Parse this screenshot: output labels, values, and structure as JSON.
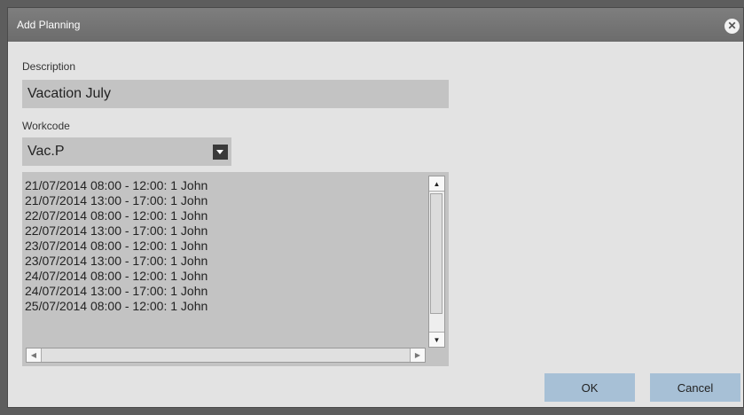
{
  "dialog": {
    "title": "Add Planning",
    "close_icon": "close-icon"
  },
  "description": {
    "label": "Description",
    "value": "Vacation July"
  },
  "workcode": {
    "label": "Workcode",
    "selected": "Vac.P"
  },
  "planning_list": {
    "items": [
      "21/07/2014 08:00 - 12:00: 1 John",
      "21/07/2014 13:00 - 17:00: 1 John",
      "22/07/2014 08:00 - 12:00: 1 John",
      "22/07/2014 13:00 - 17:00: 1 John",
      "23/07/2014 08:00 - 12:00: 1 John",
      "23/07/2014 13:00 - 17:00: 1 John",
      "24/07/2014 08:00 - 12:00: 1 John",
      "24/07/2014 13:00 - 17:00: 1 John",
      "25/07/2014 08:00 - 12:00: 1 John"
    ]
  },
  "buttons": {
    "ok_label": "OK",
    "cancel_label": "Cancel"
  },
  "colors": {
    "titlebar": "#737373",
    "dialog_background": "#e3e3e3",
    "field_background": "#c3c3c3",
    "button_accent": "#a7c0d6"
  }
}
